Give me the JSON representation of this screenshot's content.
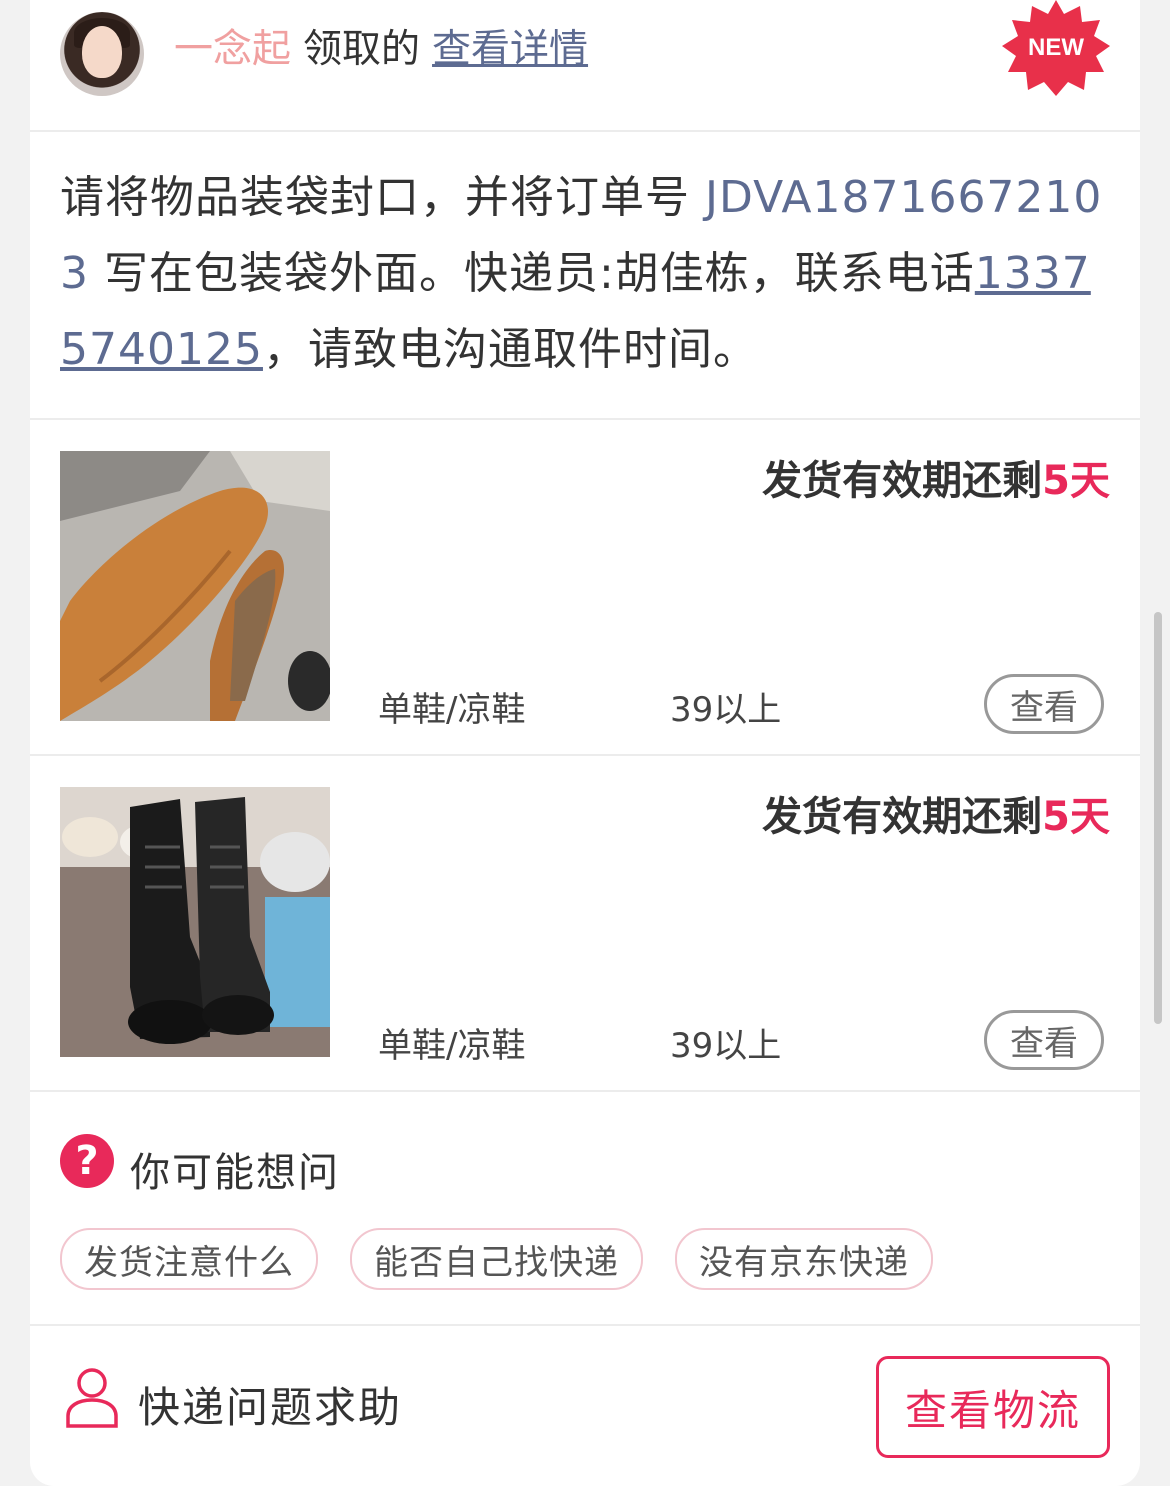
{
  "header": {
    "username": "一念起",
    "action_text": "领取的",
    "details_link": "查看详情",
    "new_badge": "NEW",
    "badge_color": "#e8304a"
  },
  "instructions": {
    "part1": "请将物品装袋封口，并将订单号 ",
    "order_no": "JDVA18716672103",
    "part2": " 写在包装袋外面。快递员:胡佳栋，联系电话",
    "phone": "13375740125",
    "part3": "，请致电沟通取件时间。"
  },
  "items": [
    {
      "image_icon": "orange-loafer-photo",
      "deadline_prefix": "发货有效期还剩",
      "deadline_days": "5天",
      "category": "单鞋/凉鞋",
      "size": "39以上",
      "view_label": "查看"
    },
    {
      "image_icon": "black-boots-photo",
      "deadline_prefix": "发货有效期还剩",
      "deadline_days": "5天",
      "category": "单鞋/凉鞋",
      "size": "39以上",
      "view_label": "查看"
    }
  ],
  "faq": {
    "icon": "question-icon",
    "title": "你可能想问",
    "chips": [
      "发货注意什么",
      "能否自己找快递",
      "没有京东快递"
    ]
  },
  "footer": {
    "icon": "person-icon",
    "help_text": "快递问题求助",
    "logistics_button": "查看物流"
  },
  "colors": {
    "accent": "#e8295a",
    "link": "#5d6b91",
    "username": "#f0a0a0"
  }
}
